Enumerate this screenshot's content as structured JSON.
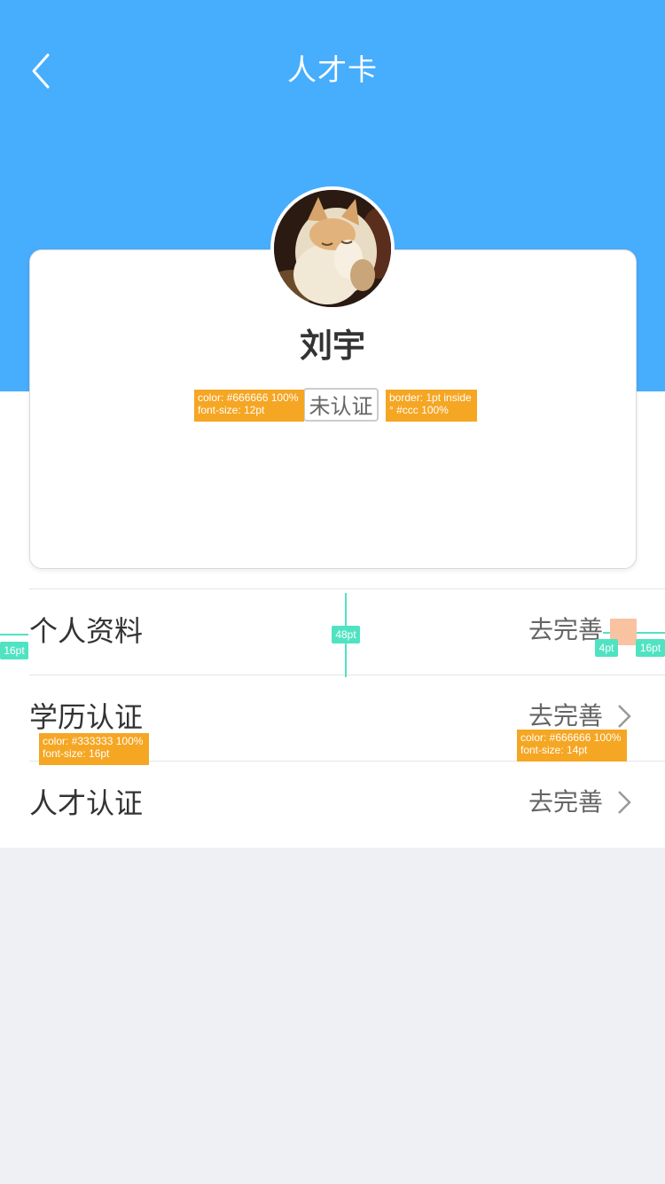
{
  "header": {
    "title": "人才卡",
    "background_color": "#47adfd",
    "back_icon": "chevron-left-icon"
  },
  "profile": {
    "name": "刘宇",
    "status_badge": "未认证",
    "avatar": "cat-photo-avatar"
  },
  "annotations": {
    "badge_text_spec": "color: #666666 100%\nfont-size: 12pt",
    "badge_border_spec": "border: 1pt inside\n° #ccc 100%",
    "row_label_spec": "color: #333333 100%\nfont-size: 16pt",
    "row_action_spec": "color: #666666 100%\nfont-size: 14pt",
    "left_margin": "16pt",
    "row_height": "48pt",
    "chevron_gap": "4pt",
    "right_margin": "16pt"
  },
  "rows": [
    {
      "label": "个人资料",
      "action": "去完善",
      "icon": "chevron-right-icon"
    },
    {
      "label": "学历认证",
      "action": "去完善",
      "icon": "chevron-right-icon"
    },
    {
      "label": "人才认证",
      "action": "去完善",
      "icon": "chevron-right-icon"
    }
  ],
  "colors": {
    "primary": "#47adfd",
    "text_primary": "#333333",
    "text_secondary": "#666666",
    "border": "#cccccc",
    "page_background": "#eff0f4",
    "annotation_orange": "#f5a623",
    "annotation_green": "#50e3c2"
  }
}
